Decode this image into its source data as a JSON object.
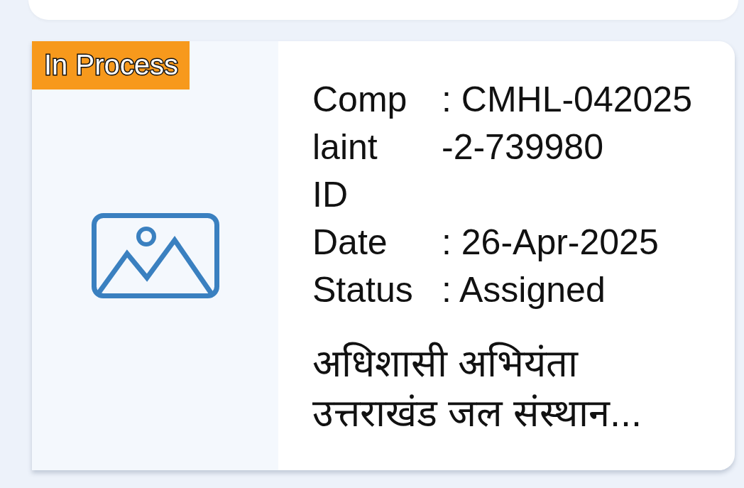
{
  "complaint_card": {
    "badge": "In Process",
    "fields": [
      {
        "label": "Complaint ID",
        "value": ": CMHL-042025-2-739980"
      },
      {
        "label": "Date",
        "value": ": 26-Apr-2025"
      },
      {
        "label": "Status",
        "value": ": Assigned"
      }
    ],
    "office": "अधिशासी अभियंता उत्तराखंड जल संस्थान..."
  }
}
